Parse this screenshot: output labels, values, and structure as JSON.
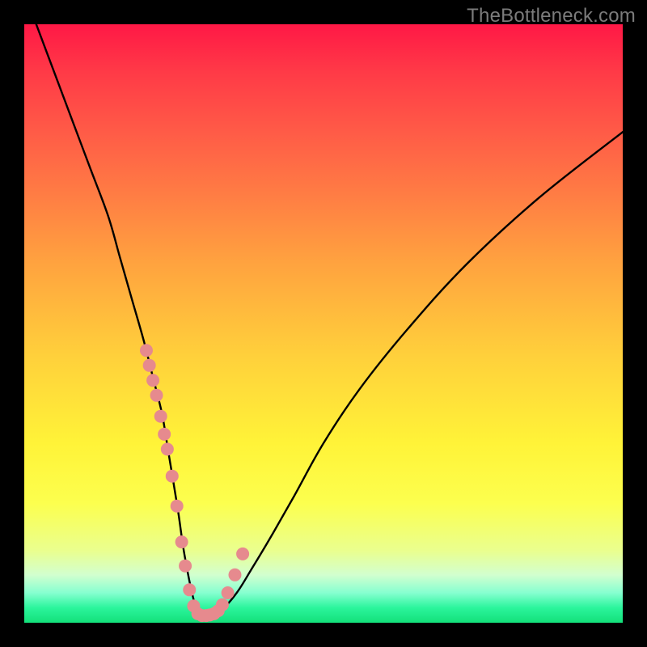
{
  "watermark": "TheBottleneck.com",
  "chart_data": {
    "type": "line",
    "title": "",
    "xlabel": "",
    "ylabel": "",
    "xlim": [
      0,
      100
    ],
    "ylim": [
      0,
      100
    ],
    "curve": {
      "x": [
        2,
        5,
        8,
        11,
        14,
        16,
        18,
        20,
        21.5,
        23,
        24,
        25,
        25.8,
        26.5,
        27.2,
        27.8,
        28.4,
        29,
        29.6,
        30.8,
        33,
        35.5,
        38,
        41,
        45,
        50,
        56,
        64,
        74,
        86,
        100
      ],
      "y": [
        100,
        92,
        84,
        76,
        68,
        61,
        54,
        47,
        41,
        35,
        29,
        23,
        18,
        13,
        9,
        6,
        3.5,
        1.8,
        1.2,
        1.2,
        2.2,
        5,
        9,
        14,
        21,
        30,
        39,
        49,
        60,
        71,
        82
      ]
    },
    "scatter_points": {
      "x": [
        20.4,
        20.9,
        21.5,
        22.1,
        22.8,
        23.4,
        23.9,
        24.7,
        25.5,
        26.3,
        26.9,
        27.6,
        28.3,
        29.0,
        29.7,
        30.4,
        31.0,
        31.7,
        32.4,
        33.1,
        34.0,
        35.2,
        36.5
      ],
      "y": [
        45.5,
        43.0,
        40.5,
        38.0,
        34.5,
        31.5,
        29.0,
        24.5,
        19.5,
        13.5,
        9.5,
        5.5,
        2.8,
        1.5,
        1.2,
        1.2,
        1.3,
        1.5,
        2.0,
        3.0,
        5.0,
        8.0,
        11.5
      ],
      "color": "#e68a8e",
      "radius": 8
    },
    "gradient_stops": [
      {
        "pos": 0.0,
        "color": "#ff1846"
      },
      {
        "pos": 0.18,
        "color": "#ff5b47"
      },
      {
        "pos": 0.4,
        "color": "#ffa33f"
      },
      {
        "pos": 0.7,
        "color": "#fff338"
      },
      {
        "pos": 0.92,
        "color": "#d2ffcf"
      },
      {
        "pos": 1.0,
        "color": "#13e07a"
      }
    ]
  }
}
